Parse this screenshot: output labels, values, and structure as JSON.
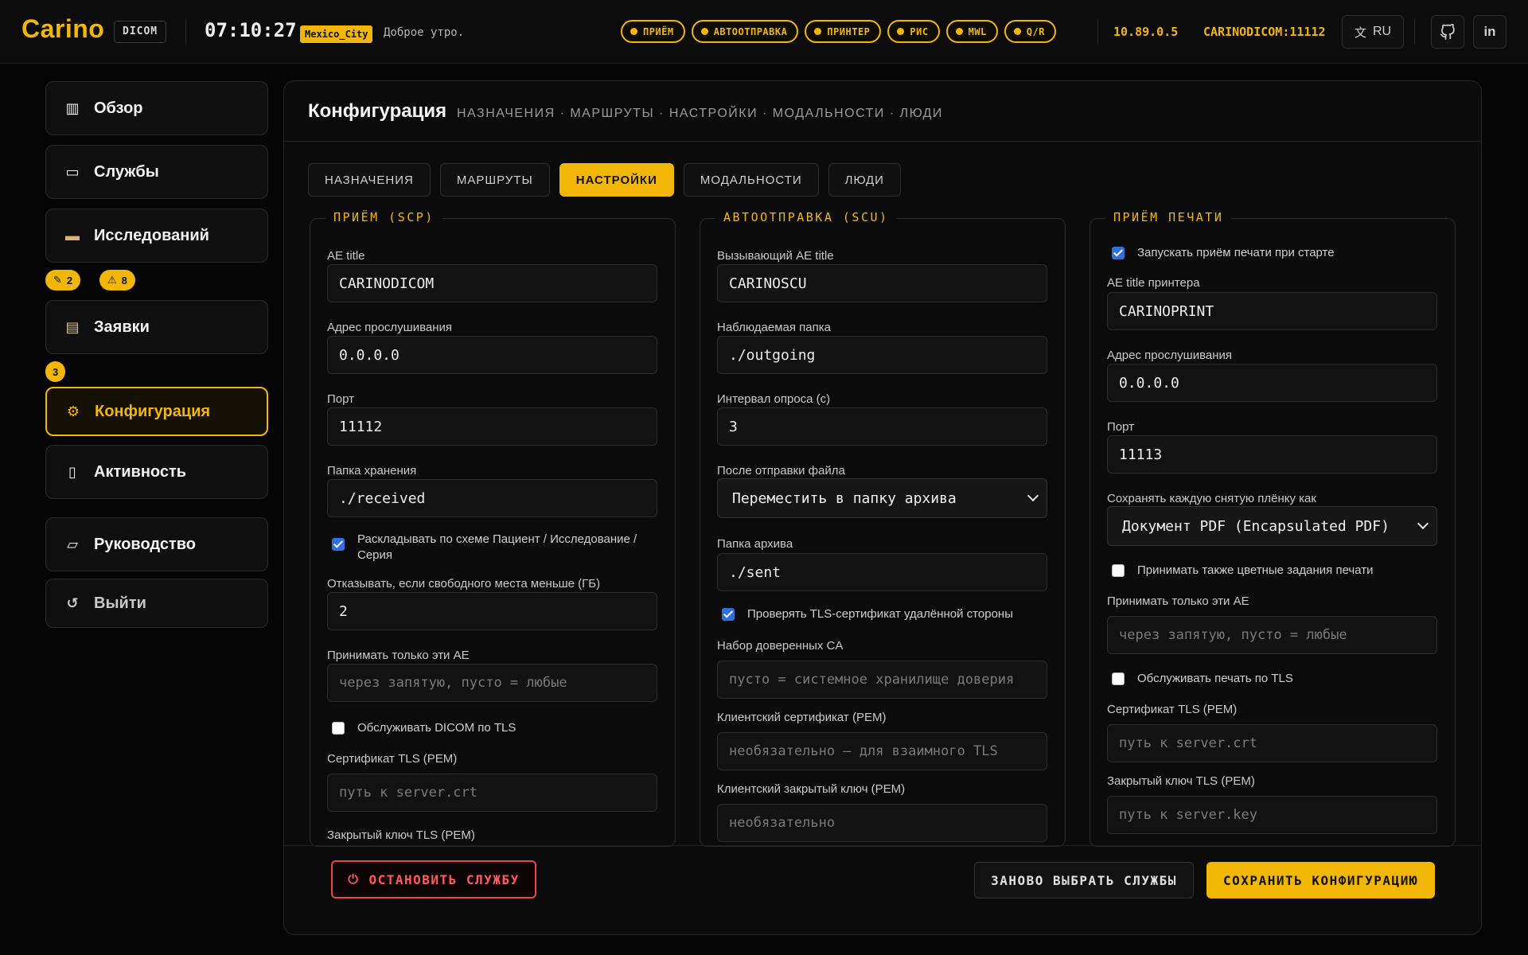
{
  "header": {
    "logo": "Carino",
    "logo_tag": "DICOM",
    "clock": "07:10:27",
    "timezone": "Mexico_City",
    "greeting": "Доброе утро.",
    "chips": [
      "ПРИЁМ",
      "АВТООТПРАВКА",
      "ПРИНТЕР",
      "РИС",
      "MWL",
      "Q/R"
    ],
    "ip": "10.89.0.5",
    "ae": "CARINODICOM:11112",
    "lang": "RU",
    "accent_color": "#f2b705"
  },
  "sidebar": {
    "items": [
      {
        "label": "Обзор",
        "icon": "bar-chart-icon"
      },
      {
        "label": "Службы",
        "icon": "monitor-icon"
      },
      {
        "label": "Исследований",
        "icon": "folder-icon"
      },
      {
        "label": "Заявки",
        "icon": "clipboard-icon"
      },
      {
        "label": "Конфигурация",
        "icon": "gear-icon"
      },
      {
        "label": "Активность",
        "icon": "document-icon"
      },
      {
        "label": "Руководство",
        "icon": "book-icon"
      },
      {
        "label": "Выйти",
        "icon": "logout-icon"
      }
    ],
    "badges": {
      "studies_edit": "2",
      "studies_warn": "8",
      "orders": "3"
    }
  },
  "main": {
    "title": "Конфигурация",
    "crumbs": "НАЗНАЧЕНИЯ · МАРШРУТЫ · НАСТРОЙКИ · МОДАЛЬНОСТИ · ЛЮДИ",
    "tabs": [
      {
        "label": "НАЗНАЧЕНИЯ"
      },
      {
        "label": "МАРШРУТЫ"
      },
      {
        "label": "НАСТРОЙКИ"
      },
      {
        "label": "МОДАЛЬНОСТИ"
      },
      {
        "label": "ЛЮДИ"
      }
    ],
    "scp": {
      "legend": "ПРИЁМ (SCP)",
      "ae_label": "AE title",
      "ae_value": "CARINODICOM",
      "addr_label": "Адрес прослушивания",
      "addr_value": "0.0.0.0",
      "port_label": "Порт",
      "port_value": "11112",
      "folder_label": "Папка хранения",
      "folder_value": "./received",
      "sort_label": "Раскладывать по схеме Пациент / Исследование / Серия",
      "space_label": "Отказывать, если свободного места меньше (ГБ)",
      "space_value": "2",
      "allow_label": "Принимать только эти AE",
      "allow_placeholder": "через запятую, пусто = любые",
      "tls_label": "Обслуживать DICOM по TLS",
      "cert_label": "Сертификат TLS (PEM)",
      "cert_placeholder": "путь к server.crt",
      "key_label": "Закрытый ключ TLS (PEM)"
    },
    "scu": {
      "legend": "АВТООТПРАВКА (SCU)",
      "ae_label": "Вызывающий AE title",
      "ae_value": "CARINOSCU",
      "watch_label": "Наблюдаемая папка",
      "watch_value": "./outgoing",
      "poll_label": "Интервал опроса (с)",
      "poll_value": "3",
      "after_label": "После отправки файла",
      "after_value": "Переместить в папку архива",
      "archive_label": "Папка архива",
      "archive_value": "./sent",
      "verify_label": "Проверять TLS-сертификат удалённой стороны",
      "ca_label": "Набор доверенных CA",
      "ca_placeholder": "пусто = системное хранилище доверия",
      "client_cert_label": "Клиентский сертификат (PEM)",
      "client_cert_placeholder": "необязательно — для взаимного TLS",
      "client_key_label": "Клиентский закрытый ключ (PEM)",
      "client_key_placeholder": "необязательно"
    },
    "print": {
      "legend": "ПРИЁМ ПЕЧАТИ",
      "autostart_label": "Запускать приём печати при старте",
      "ae_label": "AE title принтера",
      "ae_value": "CARINOPRINT",
      "addr_label": "Адрес прослушивания",
      "addr_value": "0.0.0.0",
      "port_label": "Порт",
      "port_value": "11113",
      "save_label": "Сохранять каждую снятую плёнку как",
      "save_value": "Документ PDF (Encapsulated PDF)",
      "color_label": "Принимать также цветные задания печати",
      "allow_label": "Принимать только эти AE",
      "allow_placeholder": "через запятую, пусто = любые",
      "tls_label": "Обслуживать печать по TLS",
      "cert_label": "Сертификат TLS (PEM)",
      "cert_placeholder": "путь к server.crt",
      "key_label": "Закрытый ключ TLS (PEM)",
      "key_placeholder": "путь к server.key"
    },
    "footer": {
      "stop": "ОСТАНОВИТЬ СЛУЖБУ",
      "reselect": "ЗАНОВО ВЫБРАТЬ СЛУЖБЫ",
      "save": "СОХРАНИТЬ КОНФИГУРАЦИЮ"
    }
  }
}
